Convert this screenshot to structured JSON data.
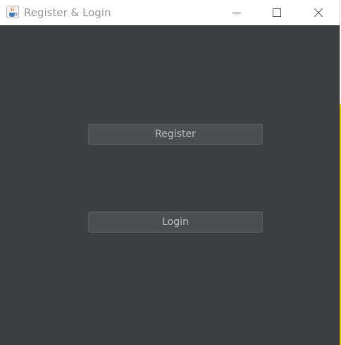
{
  "window": {
    "title": "Register & Login",
    "icon": "java-cup-icon"
  },
  "title_controls": {
    "minimize_icon": "minimize-icon",
    "maximize_icon": "maximize-icon",
    "close_icon": "close-icon"
  },
  "buttons": {
    "register_label": "Register",
    "login_label": "Login"
  },
  "colors": {
    "background": "#3c3f41",
    "button_bg": "#4c5052",
    "button_text": "#bbbbbb",
    "titlebar_bg": "#ffffff",
    "accent_strip": "#e6c200"
  }
}
